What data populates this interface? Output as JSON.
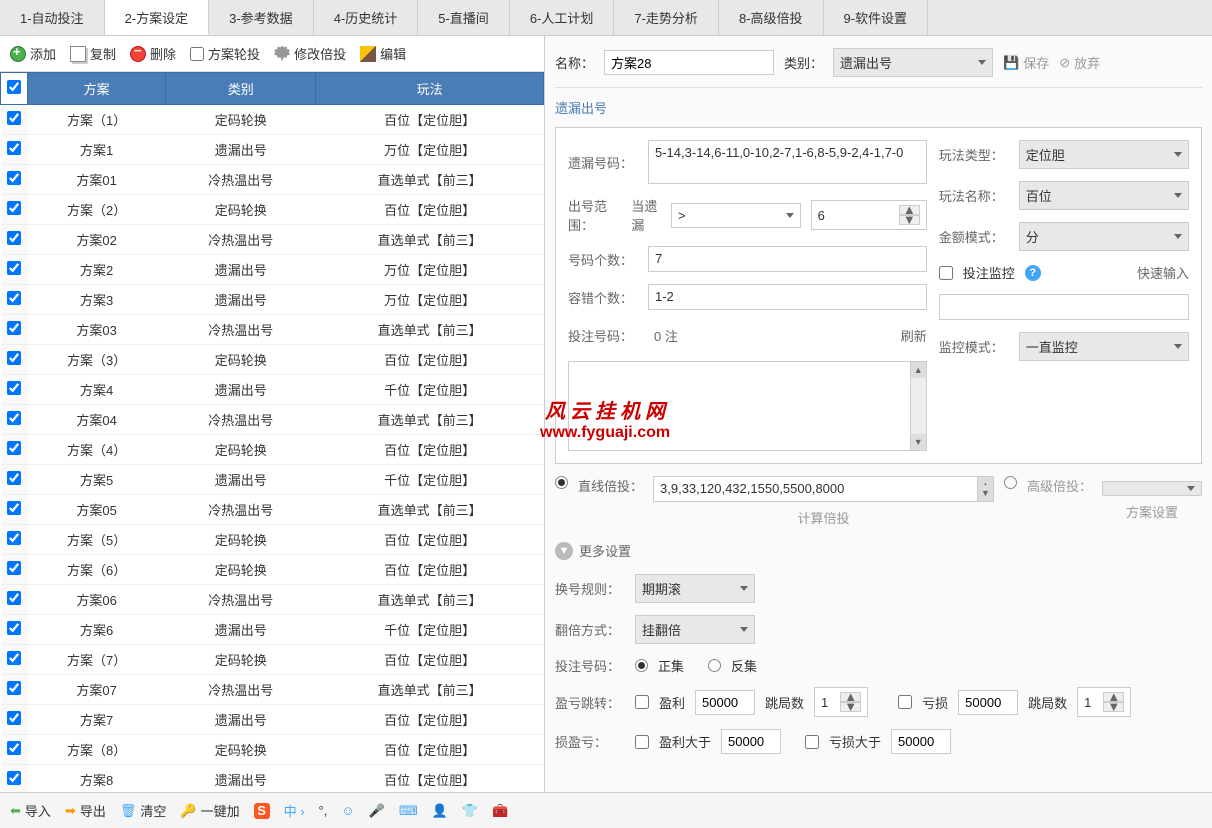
{
  "tabs": [
    "1-自动投注",
    "2-方案设定",
    "3-参考数据",
    "4-历史统计",
    "5-直播间",
    "6-人工计划",
    "7-走势分析",
    "8-高级倍投",
    "9-软件设置"
  ],
  "activeTab": 1,
  "leftToolbar": {
    "add": "添加",
    "copy": "复制",
    "delete": "删除",
    "planRotate": "方案轮投",
    "modifyMultiplier": "修改倍投",
    "edit": "编辑"
  },
  "tableHeaders": [
    "方案",
    "类别",
    "玩法"
  ],
  "tableRows": [
    [
      "方案（1）",
      "定码轮换",
      "百位【定位胆】"
    ],
    [
      "方案1",
      "遗漏出号",
      "万位【定位胆】"
    ],
    [
      "方案01",
      "冷热温出号",
      "直选单式【前三】"
    ],
    [
      "方案（2）",
      "定码轮换",
      "百位【定位胆】"
    ],
    [
      "方案02",
      "冷热温出号",
      "直选单式【前三】"
    ],
    [
      "方案2",
      "遗漏出号",
      "万位【定位胆】"
    ],
    [
      "方案3",
      "遗漏出号",
      "万位【定位胆】"
    ],
    [
      "方案03",
      "冷热温出号",
      "直选单式【前三】"
    ],
    [
      "方案（3）",
      "定码轮换",
      "百位【定位胆】"
    ],
    [
      "方案4",
      "遗漏出号",
      "千位【定位胆】"
    ],
    [
      "方案04",
      "冷热温出号",
      "直选单式【前三】"
    ],
    [
      "方案（4）",
      "定码轮换",
      "百位【定位胆】"
    ],
    [
      "方案5",
      "遗漏出号",
      "千位【定位胆】"
    ],
    [
      "方案05",
      "冷热温出号",
      "直选单式【前三】"
    ],
    [
      "方案（5）",
      "定码轮换",
      "百位【定位胆】"
    ],
    [
      "方案（6）",
      "定码轮换",
      "百位【定位胆】"
    ],
    [
      "方案06",
      "冷热温出号",
      "直选单式【前三】"
    ],
    [
      "方案6",
      "遗漏出号",
      "千位【定位胆】"
    ],
    [
      "方案（7）",
      "定码轮换",
      "百位【定位胆】"
    ],
    [
      "方案07",
      "冷热温出号",
      "直选单式【前三】"
    ],
    [
      "方案7",
      "遗漏出号",
      "百位【定位胆】"
    ],
    [
      "方案（8）",
      "定码轮换",
      "百位【定位胆】"
    ],
    [
      "方案8",
      "遗漏出号",
      "百位【定位胆】"
    ]
  ],
  "rightTop": {
    "nameLabel": "名称：",
    "nameValue": "方案28",
    "categoryLabel": "类别：",
    "categoryValue": "遗漏出号",
    "save": "保存",
    "discard": "放弃"
  },
  "rightSection": "遗漏出号",
  "missConfig": {
    "missCodeLabel": "遗漏号码：",
    "missCodeValue": "5-14,3-14,6-11,0-10,2-7,1-6,8-5,9-2,4-1,7-0",
    "rangeLabel": "出号范围：",
    "rangeWhen": "当遗漏",
    "rangeOp": ">",
    "rangeVal": "6",
    "countLabel": "号码个数：",
    "countValue": "7",
    "errorLabel": "容错个数：",
    "errorValue": "1-2",
    "betCodeLabel": "投注号码：",
    "betCodeValue": "0 注",
    "refresh": "刷新"
  },
  "rightConfig": {
    "playTypeLabel": "玩法类型：",
    "playTypeValue": "定位胆",
    "playNameLabel": "玩法名称：",
    "playNameValue": "百位",
    "amountModeLabel": "金额模式：",
    "amountModeValue": "分",
    "betMonitor": "投注监控",
    "quickInput": "快速输入",
    "monitorModeLabel": "监控模式：",
    "monitorModeValue": "一直监控"
  },
  "multiplier": {
    "lineLabel": "直线倍投：",
    "lineValue": "3,9,33,120,432,1550,5500,8000",
    "calcLabel": "计算倍投",
    "advLabel": "高级倍投：",
    "planLabel": "方案设置"
  },
  "more": {
    "title": "更多设置",
    "switchRuleLabel": "换号规则：",
    "switchRuleValue": "期期滚",
    "flipLabel": "翻倍方式：",
    "flipValue": "挂翻倍",
    "betNumLabel": "投注号码：",
    "positive": "正集",
    "negative": "反集",
    "jumpLabel": "盈亏跳转：",
    "profit": "盈利",
    "profitVal": "50000",
    "jumpCount": "跳局数",
    "jumpCountVal": "1",
    "loss": "亏损",
    "lossVal": "50000",
    "stopLabel": "损盈亏：",
    "profitGt": "盈利大于",
    "profitGtVal": "50000",
    "lossGt": "亏损大于",
    "lossGtVal": "50000"
  },
  "footer": {
    "import": "导入",
    "export": "导出",
    "clear": "清空",
    "oneKey": "一键加",
    "sogou": "S",
    "cn": "中"
  },
  "watermark": {
    "l1": "风 云 挂 机 网",
    "l2": "www.fyguaji.com"
  }
}
